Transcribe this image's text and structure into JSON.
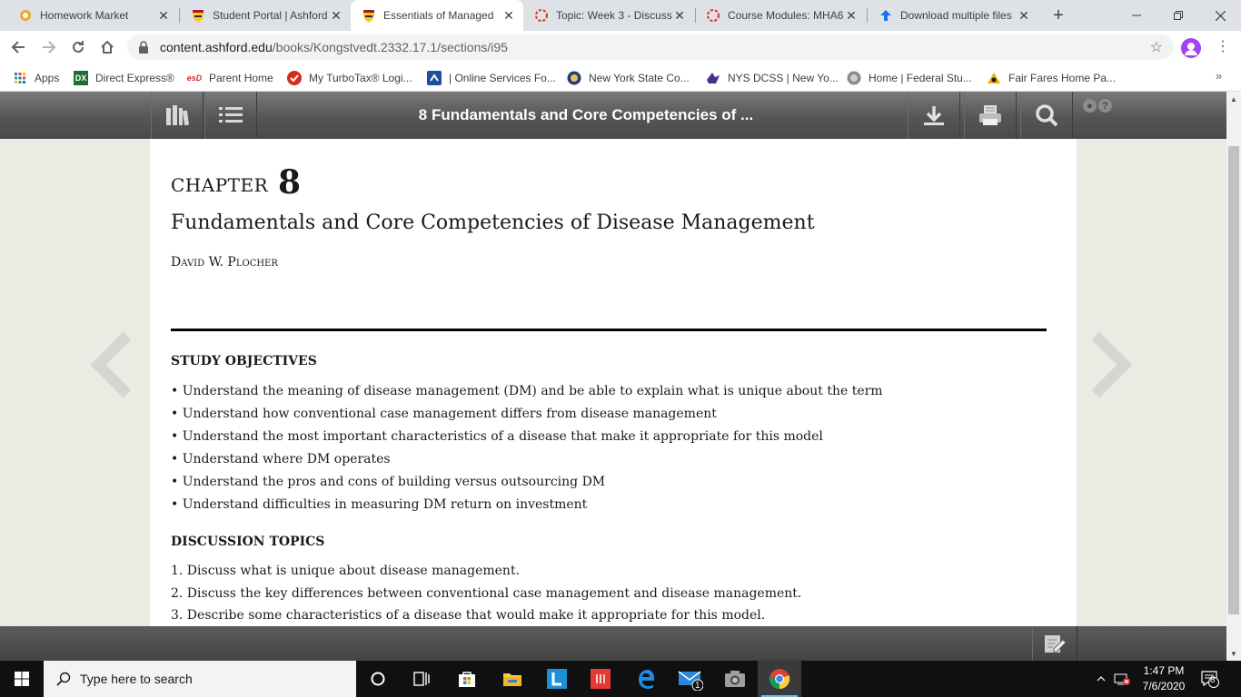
{
  "browser": {
    "tabs": [
      {
        "title": "Homework Market",
        "favicon": "homework-market-icon",
        "active": false
      },
      {
        "title": "Student Portal | Ashford",
        "favicon": "ashford-shield-icon",
        "active": false
      },
      {
        "title": "Essentials of Managed",
        "favicon": "ashford-shield-icon",
        "active": true
      },
      {
        "title": "Topic: Week 3 - Discuss",
        "favicon": "loading-ring-icon",
        "active": false
      },
      {
        "title": "Course Modules: MHA6",
        "favicon": "loading-ring-icon",
        "active": false
      },
      {
        "title": "Download multiple files",
        "favicon": "upload-arrow-icon",
        "active": false
      }
    ],
    "url_host": "content.ashford.edu",
    "url_path": "/books/Kongstvedt.2332.17.1/sections/i95",
    "bookmarks": [
      {
        "label": "Apps",
        "icon": "apps-grid-icon"
      },
      {
        "label": "Direct Express®",
        "icon": "direct-express-icon",
        "badge": "DX"
      },
      {
        "label": "Parent Home",
        "icon": "esd-icon",
        "badge": "esD"
      },
      {
        "label": "My TurboTax® Logi...",
        "icon": "turbotax-icon"
      },
      {
        "label": "| Online Services Fo...",
        "icon": "online-services-icon"
      },
      {
        "label": "New York State Co...",
        "icon": "ny-seal-icon"
      },
      {
        "label": "NYS DCSS | New Yo...",
        "icon": "dcss-icon"
      },
      {
        "label": "Home | Federal Stu...",
        "icon": "federal-student-aid-icon"
      },
      {
        "label": "Fair Fares Home Pa...",
        "icon": "fair-fares-icon"
      }
    ]
  },
  "reader": {
    "toolbar_title": "8 Fundamentals and Core Competencies of ...",
    "chapter_label": "CHAPTER",
    "chapter_number": "8",
    "chapter_title": "Fundamentals and Core Competencies of Disease Management",
    "author": "David W. Plocher",
    "study_objectives_heading": "STUDY OBJECTIVES",
    "study_objectives": [
      "• Understand the meaning of disease management (DM) and be able to explain what is unique about the term",
      "• Understand how conventional case management differs from disease management",
      "• Understand the most important characteristics of a disease that make it appropriate for this model",
      "• Understand where DM operates",
      "• Understand the pros and cons of building versus outsourcing DM",
      "• Understand difficulties in measuring DM return on investment"
    ],
    "discussion_heading": "DISCUSSION TOPICS",
    "discussion_topics": [
      "1. Discuss what is unique about disease management.",
      "2. Discuss the key differences between conventional case management and disease management.",
      "3. Describe some characteristics of a disease that would make it appropriate for this model."
    ]
  },
  "taskbar": {
    "search_placeholder": "Type here to search",
    "time": "1:47 PM",
    "date": "7/6/2020",
    "mail_badge": "1",
    "notification_count": "8"
  }
}
